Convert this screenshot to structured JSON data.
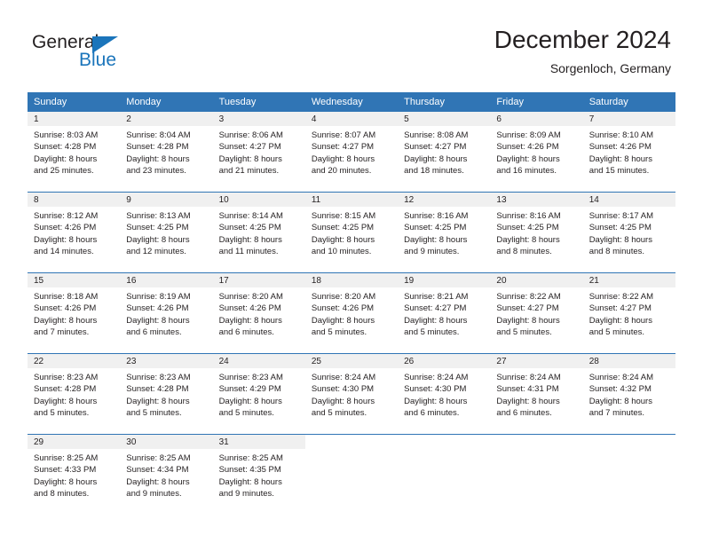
{
  "logo": {
    "word_one": "General",
    "word_two": "Blue",
    "accent_color": "#1b75bb",
    "triangle_icon": "triangle-icon"
  },
  "header": {
    "title": "December 2024",
    "subtitle": "Sorgenloch, Germany",
    "header_bg": "#3075b5",
    "header_text_color": "#ffffff"
  },
  "weekday_headers": [
    "Sunday",
    "Monday",
    "Tuesday",
    "Wednesday",
    "Thursday",
    "Friday",
    "Saturday"
  ],
  "weeks": [
    [
      {
        "day": "1",
        "sunrise": "Sunrise: 8:03 AM",
        "sunset": "Sunset: 4:28 PM",
        "daylight_line1": "Daylight: 8 hours",
        "daylight_line2": "and 25 minutes."
      },
      {
        "day": "2",
        "sunrise": "Sunrise: 8:04 AM",
        "sunset": "Sunset: 4:28 PM",
        "daylight_line1": "Daylight: 8 hours",
        "daylight_line2": "and 23 minutes."
      },
      {
        "day": "3",
        "sunrise": "Sunrise: 8:06 AM",
        "sunset": "Sunset: 4:27 PM",
        "daylight_line1": "Daylight: 8 hours",
        "daylight_line2": "and 21 minutes."
      },
      {
        "day": "4",
        "sunrise": "Sunrise: 8:07 AM",
        "sunset": "Sunset: 4:27 PM",
        "daylight_line1": "Daylight: 8 hours",
        "daylight_line2": "and 20 minutes."
      },
      {
        "day": "5",
        "sunrise": "Sunrise: 8:08 AM",
        "sunset": "Sunset: 4:27 PM",
        "daylight_line1": "Daylight: 8 hours",
        "daylight_line2": "and 18 minutes."
      },
      {
        "day": "6",
        "sunrise": "Sunrise: 8:09 AM",
        "sunset": "Sunset: 4:26 PM",
        "daylight_line1": "Daylight: 8 hours",
        "daylight_line2": "and 16 minutes."
      },
      {
        "day": "7",
        "sunrise": "Sunrise: 8:10 AM",
        "sunset": "Sunset: 4:26 PM",
        "daylight_line1": "Daylight: 8 hours",
        "daylight_line2": "and 15 minutes."
      }
    ],
    [
      {
        "day": "8",
        "sunrise": "Sunrise: 8:12 AM",
        "sunset": "Sunset: 4:26 PM",
        "daylight_line1": "Daylight: 8 hours",
        "daylight_line2": "and 14 minutes."
      },
      {
        "day": "9",
        "sunrise": "Sunrise: 8:13 AM",
        "sunset": "Sunset: 4:25 PM",
        "daylight_line1": "Daylight: 8 hours",
        "daylight_line2": "and 12 minutes."
      },
      {
        "day": "10",
        "sunrise": "Sunrise: 8:14 AM",
        "sunset": "Sunset: 4:25 PM",
        "daylight_line1": "Daylight: 8 hours",
        "daylight_line2": "and 11 minutes."
      },
      {
        "day": "11",
        "sunrise": "Sunrise: 8:15 AM",
        "sunset": "Sunset: 4:25 PM",
        "daylight_line1": "Daylight: 8 hours",
        "daylight_line2": "and 10 minutes."
      },
      {
        "day": "12",
        "sunrise": "Sunrise: 8:16 AM",
        "sunset": "Sunset: 4:25 PM",
        "daylight_line1": "Daylight: 8 hours",
        "daylight_line2": "and 9 minutes."
      },
      {
        "day": "13",
        "sunrise": "Sunrise: 8:16 AM",
        "sunset": "Sunset: 4:25 PM",
        "daylight_line1": "Daylight: 8 hours",
        "daylight_line2": "and 8 minutes."
      },
      {
        "day": "14",
        "sunrise": "Sunrise: 8:17 AM",
        "sunset": "Sunset: 4:25 PM",
        "daylight_line1": "Daylight: 8 hours",
        "daylight_line2": "and 8 minutes."
      }
    ],
    [
      {
        "day": "15",
        "sunrise": "Sunrise: 8:18 AM",
        "sunset": "Sunset: 4:26 PM",
        "daylight_line1": "Daylight: 8 hours",
        "daylight_line2": "and 7 minutes."
      },
      {
        "day": "16",
        "sunrise": "Sunrise: 8:19 AM",
        "sunset": "Sunset: 4:26 PM",
        "daylight_line1": "Daylight: 8 hours",
        "daylight_line2": "and 6 minutes."
      },
      {
        "day": "17",
        "sunrise": "Sunrise: 8:20 AM",
        "sunset": "Sunset: 4:26 PM",
        "daylight_line1": "Daylight: 8 hours",
        "daylight_line2": "and 6 minutes."
      },
      {
        "day": "18",
        "sunrise": "Sunrise: 8:20 AM",
        "sunset": "Sunset: 4:26 PM",
        "daylight_line1": "Daylight: 8 hours",
        "daylight_line2": "and 5 minutes."
      },
      {
        "day": "19",
        "sunrise": "Sunrise: 8:21 AM",
        "sunset": "Sunset: 4:27 PM",
        "daylight_line1": "Daylight: 8 hours",
        "daylight_line2": "and 5 minutes."
      },
      {
        "day": "20",
        "sunrise": "Sunrise: 8:22 AM",
        "sunset": "Sunset: 4:27 PM",
        "daylight_line1": "Daylight: 8 hours",
        "daylight_line2": "and 5 minutes."
      },
      {
        "day": "21",
        "sunrise": "Sunrise: 8:22 AM",
        "sunset": "Sunset: 4:27 PM",
        "daylight_line1": "Daylight: 8 hours",
        "daylight_line2": "and 5 minutes."
      }
    ],
    [
      {
        "day": "22",
        "sunrise": "Sunrise: 8:23 AM",
        "sunset": "Sunset: 4:28 PM",
        "daylight_line1": "Daylight: 8 hours",
        "daylight_line2": "and 5 minutes."
      },
      {
        "day": "23",
        "sunrise": "Sunrise: 8:23 AM",
        "sunset": "Sunset: 4:28 PM",
        "daylight_line1": "Daylight: 8 hours",
        "daylight_line2": "and 5 minutes."
      },
      {
        "day": "24",
        "sunrise": "Sunrise: 8:23 AM",
        "sunset": "Sunset: 4:29 PM",
        "daylight_line1": "Daylight: 8 hours",
        "daylight_line2": "and 5 minutes."
      },
      {
        "day": "25",
        "sunrise": "Sunrise: 8:24 AM",
        "sunset": "Sunset: 4:30 PM",
        "daylight_line1": "Daylight: 8 hours",
        "daylight_line2": "and 5 minutes."
      },
      {
        "day": "26",
        "sunrise": "Sunrise: 8:24 AM",
        "sunset": "Sunset: 4:30 PM",
        "daylight_line1": "Daylight: 8 hours",
        "daylight_line2": "and 6 minutes."
      },
      {
        "day": "27",
        "sunrise": "Sunrise: 8:24 AM",
        "sunset": "Sunset: 4:31 PM",
        "daylight_line1": "Daylight: 8 hours",
        "daylight_line2": "and 6 minutes."
      },
      {
        "day": "28",
        "sunrise": "Sunrise: 8:24 AM",
        "sunset": "Sunset: 4:32 PM",
        "daylight_line1": "Daylight: 8 hours",
        "daylight_line2": "and 7 minutes."
      }
    ],
    [
      {
        "day": "29",
        "sunrise": "Sunrise: 8:25 AM",
        "sunset": "Sunset: 4:33 PM",
        "daylight_line1": "Daylight: 8 hours",
        "daylight_line2": "and 8 minutes."
      },
      {
        "day": "30",
        "sunrise": "Sunrise: 8:25 AM",
        "sunset": "Sunset: 4:34 PM",
        "daylight_line1": "Daylight: 8 hours",
        "daylight_line2": "and 9 minutes."
      },
      {
        "day": "31",
        "sunrise": "Sunrise: 8:25 AM",
        "sunset": "Sunset: 4:35 PM",
        "daylight_line1": "Daylight: 8 hours",
        "daylight_line2": "and 9 minutes."
      },
      {
        "day": "",
        "sunrise": "",
        "sunset": "",
        "daylight_line1": "",
        "daylight_line2": ""
      },
      {
        "day": "",
        "sunrise": "",
        "sunset": "",
        "daylight_line1": "",
        "daylight_line2": ""
      },
      {
        "day": "",
        "sunrise": "",
        "sunset": "",
        "daylight_line1": "",
        "daylight_line2": ""
      },
      {
        "day": "",
        "sunrise": "",
        "sunset": "",
        "daylight_line1": "",
        "daylight_line2": ""
      }
    ]
  ]
}
